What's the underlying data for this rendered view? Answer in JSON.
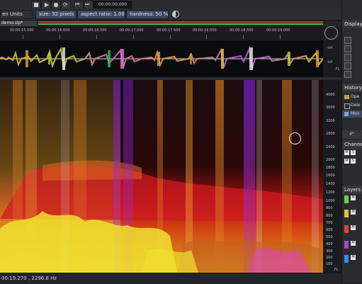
{
  "transport": {
    "time": "00:00:00.000",
    "buttons": [
      "stop",
      "play",
      "record",
      "loop",
      "skip-back",
      "skip-forward"
    ]
  },
  "toolbar": {
    "units": "en Units",
    "size": "size: 32 pixels",
    "aspect": "aspect ratio: 1.00",
    "hardness": "hardness: 50 %"
  },
  "file_tab": "demo.slp*",
  "timeline": {
    "ticks": [
      "00:00:15.500",
      "00:00:16.000",
      "00:00:16.500",
      "00:00:17.000",
      "00:00:17.500",
      "00:00:18.000",
      "00:00:18.500",
      "00:00:19.000"
    ]
  },
  "wave_axis": [
    "-inf",
    "-inf",
    "FL"
  ],
  "freq_axis": [
    "4000",
    "3600",
    "3200",
    "2800",
    "2400",
    "2000",
    "1800",
    "1600",
    "1400",
    "1200",
    "1000",
    "900",
    "800",
    "700",
    "600",
    "500",
    "400",
    "300",
    "200",
    "100",
    "FL"
  ],
  "status": "00:19.270 , 2296.8 Hz",
  "panels": {
    "display": "Display",
    "history": "History",
    "history_items": [
      "Ope",
      "Dele",
      "Mov"
    ],
    "channels": "Channel",
    "layers": "Layers"
  },
  "layer_colors": [
    "#6cd246",
    "#e0c03a",
    "#e04040",
    "#a04ad0",
    "#3a8ae0"
  ],
  "accent": "#3a4a63"
}
